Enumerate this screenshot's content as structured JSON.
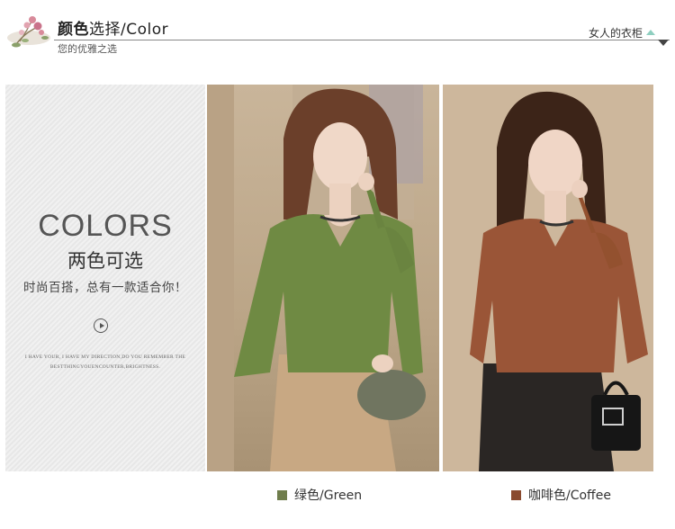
{
  "header": {
    "title_bold": "颜色",
    "title_rest": "选择/Color",
    "subtitle": "您的优雅之选",
    "tag": "女人的衣柜"
  },
  "panel": {
    "heading": "COLORS",
    "heading_cn": "两色可选",
    "tagline": "时尚百搭，总有一款适合你！",
    "small_line1": "I HAVE YOUR, I HAVE MY DIRECTION,DO YOU REMEMBER THE",
    "small_line2": "BESTTHINGYOUENCOUNTER,BRIGHTNESS."
  },
  "legend": [
    {
      "label": "绿色/Green",
      "color": "#6f7d4c"
    },
    {
      "label": "咖啡色/Coffee",
      "color": "#8a4a2f"
    }
  ],
  "colors": {
    "green_sweater": "#6f8a43",
    "coffee_sweater": "#9a5537"
  }
}
